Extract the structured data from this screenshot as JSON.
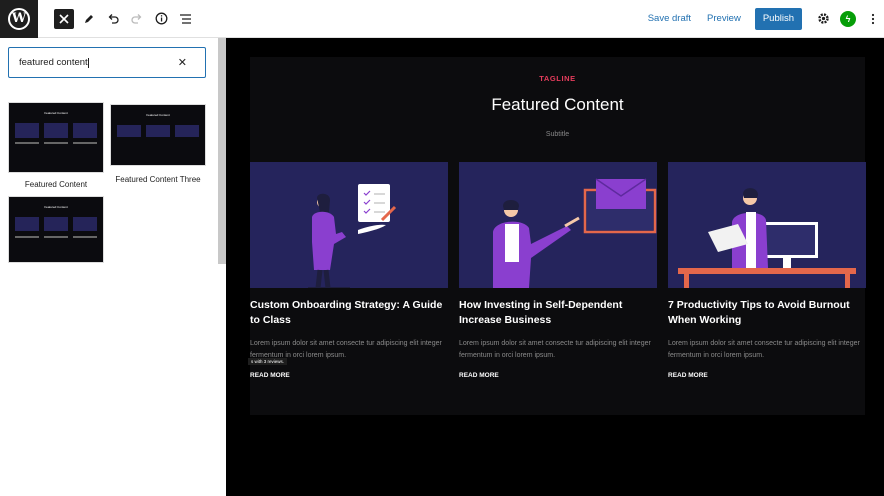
{
  "toolbar": {
    "save_draft": "Save draft",
    "preview": "Preview",
    "publish": "Publish",
    "jetpack_glyph": "ϟ"
  },
  "search": {
    "value": "featured content",
    "clear_glyph": "✕"
  },
  "patterns": [
    {
      "label": "Featured Content"
    },
    {
      "label": "Featured Content Three"
    },
    {
      "label": ""
    }
  ],
  "canvas": {
    "tagline": "TAGLINE",
    "title": "Featured Content",
    "subtitle": "Subtitle",
    "tooltip": "s with 3 reviews.",
    "cards": [
      {
        "title": "Custom Onboarding Strategy: A Guide to Class",
        "excerpt": "Lorem ipsum dolor sit amet consecte tur adipiscing elit integer fermentum in orci lorem ipsum.",
        "read_more": "READ MORE"
      },
      {
        "title": "How Investing in Self-Dependent Increase Business",
        "excerpt": "Lorem ipsum dolor sit amet consecte tur adipiscing elit integer fermentum in orci lorem ipsum.",
        "read_more": "READ MORE"
      },
      {
        "title": "7 Productivity Tips to Avoid Burnout When Working",
        "excerpt": "Lorem ipsum dolor sit amet consecte tur adipiscing elit integer fermentum in orci lorem ipsum.",
        "read_more": "READ MORE"
      }
    ]
  },
  "colors": {
    "accent": "#2271b1",
    "tagline": "#e53c5c",
    "card_bg": "#25245c",
    "purple": "#8a3fcf",
    "orange": "#e4674b"
  },
  "icons": [
    "wordpress-logo-icon",
    "close-icon",
    "pen-icon",
    "undo-icon",
    "redo-icon",
    "info-icon",
    "list-view-icon",
    "gear-icon",
    "jetpack-icon",
    "more-vertical-icon"
  ]
}
